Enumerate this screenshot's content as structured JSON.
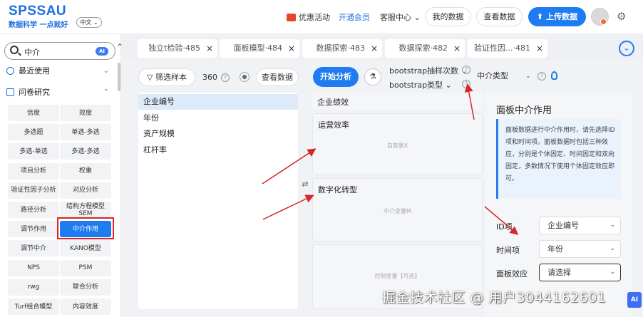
{
  "header": {
    "logo": "SPSSAU",
    "slogan": "数据科学 一点就好",
    "lang": "中文 ⌄",
    "promo": "优惠活动",
    "member": "开通会员",
    "help_center": "客服中心 ⌄",
    "my_data": "我的数据",
    "view_data": "查看数据",
    "upload": "⬆ 上传数据"
  },
  "tabs": [
    {
      "label": "独立t检验·485"
    },
    {
      "label": "面板模型·484"
    },
    {
      "label": "数据探索·483"
    },
    {
      "label": "数据探索·482"
    },
    {
      "label": "验证性因...·481"
    }
  ],
  "sidebar": {
    "search_value": "中介",
    "ai": "AI",
    "recent": "最近使用",
    "questionnaire": "问卷研究",
    "methods": [
      "信度",
      "效度",
      "多选题",
      "单选-多选",
      "多选-单选",
      "多选-多选",
      "项目分析",
      "权重",
      "验证性因子分析",
      "对应分析",
      "路径分析",
      "结构方程模型SEM",
      "调节作用",
      "中介作用",
      "调节中介",
      "KANO模型",
      "NPS",
      "PSM",
      "rwg",
      "联合分析",
      "Turf组合模型",
      "内容效度"
    ],
    "active_method": "中介作用"
  },
  "toolbar": {
    "filter": "筛选样本",
    "count": "360",
    "view_data": "查看数据",
    "start": "开始分析",
    "bootstrap_times": "bootstrap抽样次数 ⌄",
    "bootstrap_type": "bootstrap类型 ⌄",
    "mediation_type": "中介类型"
  },
  "variables": [
    "企业编号",
    "年份",
    "资产规模",
    "杠杆率"
  ],
  "drop_zones": {
    "top_item": "企业绩效",
    "x_item": "运营效率",
    "x_hint": "自变量X",
    "m_item": "数字化转型",
    "m_hint": "中介变量M",
    "c_hint": "控制变量【可选】"
  },
  "panel": {
    "title": "面板中介作用",
    "desc": "面板数据进行中介作用时，请先选择ID项和时间项。面板数据时包括三种效应，分别是个体固定、时间固定和双向固定，多数情况下使用个体固定效应即可。",
    "id_label": "ID项",
    "id_value": "企业编号",
    "time_label": "时间项",
    "time_value": "年份",
    "effect_label": "面板效应",
    "effect_value": "请选择"
  },
  "watermark": "掘金技术社区 @ 用户3044162601",
  "watermark_badge": "AI",
  "colors": {
    "primary": "#1f7bf0",
    "annotation": "#d7262c"
  }
}
